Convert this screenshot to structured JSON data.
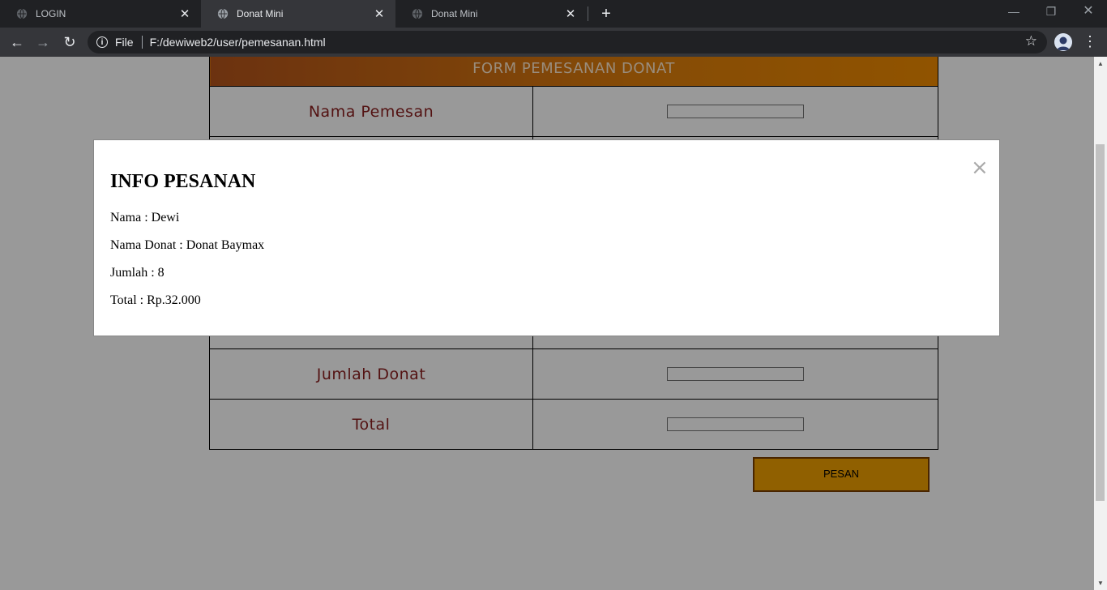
{
  "browser": {
    "tabs": [
      {
        "title": "LOGIN",
        "active": false
      },
      {
        "title": "Donat Mini",
        "active": true
      },
      {
        "title": "Donat Mini",
        "active": false
      }
    ],
    "address": {
      "scheme": "File",
      "url": "F:/dewiweb2/user/pemesanan.html"
    }
  },
  "form": {
    "header": "FORM PEMESANAN DONAT",
    "rows": [
      {
        "label": "Nama Pemesan",
        "value": ""
      },
      {
        "label": "Jumlah Donat",
        "value": ""
      },
      {
        "label": "Total",
        "value": ""
      }
    ],
    "submit_label": "PESAN"
  },
  "modal": {
    "title": "INFO PESANAN",
    "close_glyph": "×",
    "lines": [
      "Nama : Dewi",
      "Nama Donat : Donat Baymax",
      "Jumlah : 8",
      "Total : Rp.32.000"
    ]
  },
  "colors": {
    "header_gradient_start": "#b4541b",
    "header_gradient_end": "#f08b00",
    "label_text": "#8b1f1f",
    "button_bg": "#f0a000",
    "overlay": "rgba(0,0,0,0.4)"
  }
}
